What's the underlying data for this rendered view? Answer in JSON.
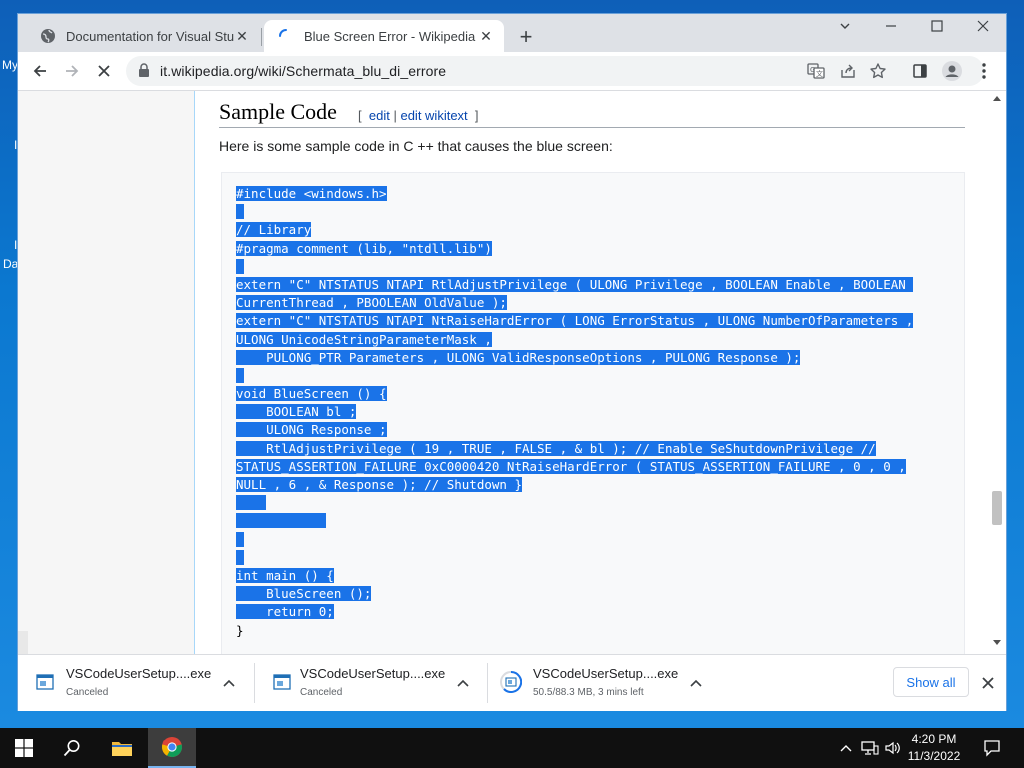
{
  "desktop": {
    "icon_labels": [
      "My",
      "I",
      "I",
      "Da"
    ]
  },
  "tabs": [
    {
      "title": "Documentation for Visual Studio",
      "active": false
    },
    {
      "title": "Blue Screen Error - Wikipedia",
      "active": true
    }
  ],
  "window_controls": {
    "tab_search": "⌄",
    "minimize": "—",
    "maximize": "☐",
    "close": "✕"
  },
  "address_bar": {
    "url": "it.wikipedia.org/wiki/Schermata_blu_di_errore"
  },
  "article": {
    "heading": "Sample Code",
    "edit_open": "[",
    "edit_link": "edit",
    "edit_sep": "|",
    "edit_wikitext_link": "edit wikitext",
    "edit_close": "]",
    "intro": "Here is some sample code in C ++ that causes the blue screen:",
    "code_lines": [
      "#include <windows.h>",
      "",
      "// Library",
      "#pragma comment (lib, \"ntdll.lib\")",
      "",
      "extern \"C\" NTSTATUS NTAPI RtlAdjustPrivilege ( ULONG Privilege , BOOLEAN Enable , BOOLEAN ",
      "CurrentThread , PBOOLEAN OldValue );",
      "extern \"C\" NTSTATUS NTAPI NtRaiseHardError ( LONG ErrorStatus , ULONG NumberOfParameters ,",
      "ULONG UnicodeStringParameterMask ,",
      "    PULONG_PTR Parameters , ULONG ValidResponseOptions , PULONG Response );",
      "",
      "void BlueScreen () {",
      "    BOOLEAN bl ;",
      "    ULONG Response ;",
      "    RtlAdjustPrivilege ( 19 , TRUE , FALSE , & bl ); // Enable SeShutdownPrivilege //",
      "STATUS_ASSERTION_FAILURE 0xC0000420 NtRaiseHardError ( STATUS_ASSERTION_FAILURE , 0 , 0 ,",
      "NULL , 6 , & Response ); // Shutdown }",
      "",
      "",
      "",
      "",
      "int main () {",
      "    BlueScreen ();",
      "    return 0;",
      "}"
    ]
  },
  "downloads": [
    {
      "name": "VSCodeUserSetup....exe",
      "status": "Canceled"
    },
    {
      "name": "VSCodeUserSetup....exe",
      "status": "Canceled"
    },
    {
      "name": "VSCodeUserSetup....exe",
      "status": "50.5/88.3 MB, 3 mins left"
    }
  ],
  "shelf": {
    "show_all": "Show all"
  },
  "taskbar": {
    "time": "4:20 PM",
    "date": "11/3/2022"
  },
  "colors": {
    "selection": "#1a73e8",
    "link": "#0645ad",
    "accent": "#1a73e8"
  }
}
